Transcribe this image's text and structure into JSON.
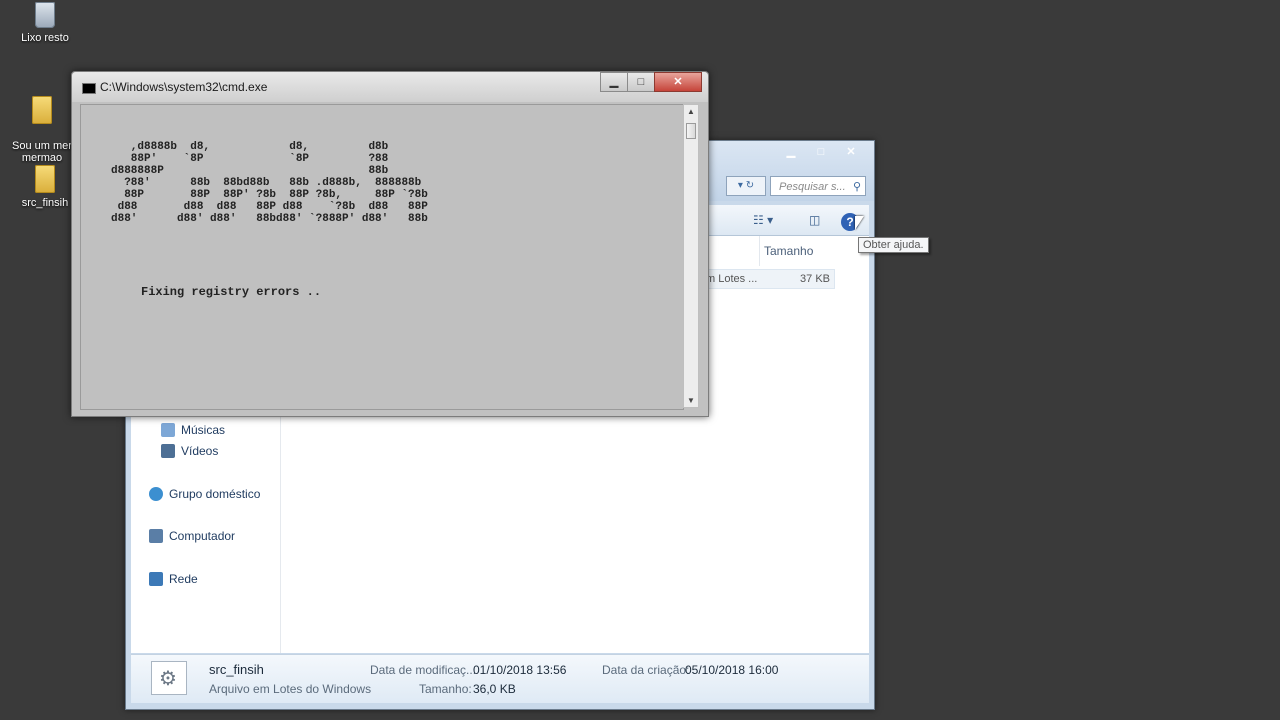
{
  "desktop": {
    "icons": [
      {
        "label": "Lixo resto",
        "icon": "recycle-bin-icon"
      },
      {
        "label": "Sou um mer\nmermao",
        "icon": "folder-icon"
      },
      {
        "label": "src_finsih",
        "icon": "folder-icon"
      }
    ]
  },
  "cmd": {
    "title": "C:\\Windows\\system32\\cmd.exe",
    "ascii_art": "   ,d8888b  d8,            d8,         d8b\n   88P'    `8P             `8P         ?88\nd888888P                               88b\n  ?88'      88b  88bd88b   88b .d888b,  888888b\n  88P       88P  88P' ?8b  88P ?8b,     88P `?8b\n d88       d88  d88   88P d88    `?8b  d88   88P\nd88'      d88' d88'   88bd88' `?888P' d88'   88b",
    "status_line": "Fixing registry errors .."
  },
  "explorer": {
    "search_placeholder": "Pesquisar s...",
    "column_size": "Tamanho",
    "file_row": {
      "name": "m Lotes ...",
      "size": "37 KB"
    },
    "nav": [
      {
        "label": "Músicas",
        "icon": "music-icon"
      },
      {
        "label": "Vídeos",
        "icon": "video-icon"
      },
      {
        "label": "Grupo doméstico",
        "icon": "homegroup-icon"
      },
      {
        "label": "Computador",
        "icon": "computer-icon"
      },
      {
        "label": "Rede",
        "icon": "network-icon"
      }
    ],
    "details": {
      "filename": "src_finsih",
      "filetype": "Arquivo em Lotes do Windows",
      "modified_label": "Data de modificaç...",
      "modified_value": "01/10/2018 13:56",
      "size_label": "Tamanho:",
      "size_value": "36,0 KB",
      "created_label": "Data da criação:",
      "created_value": "05/10/2018 16:00"
    }
  },
  "tooltip": "Obter ajuda.",
  "colors": {
    "desktop_bg": "#3a3a3a",
    "console_bg": "#c0c0c0",
    "close_red": "#c6443a"
  }
}
